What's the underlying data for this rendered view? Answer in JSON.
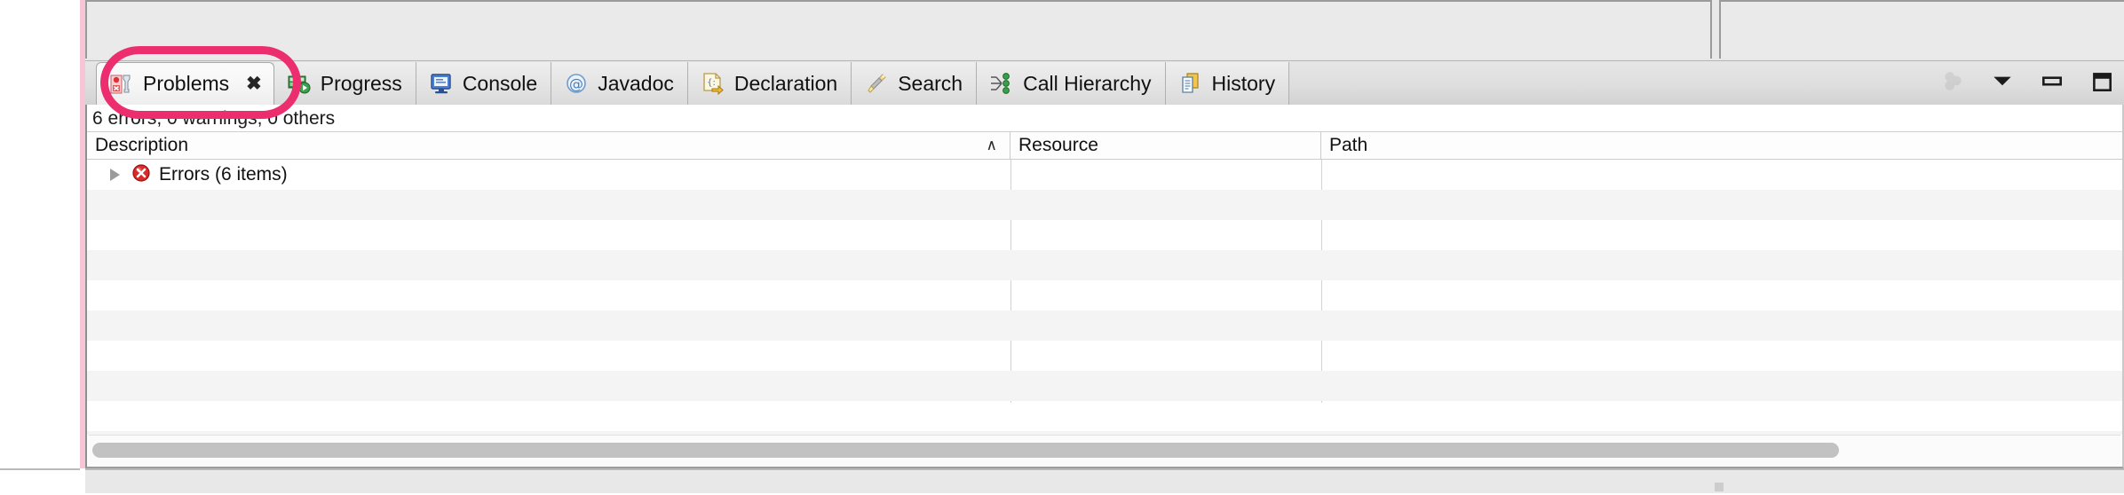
{
  "view": {
    "title": "Problems",
    "summary": "6 errors, 0 warnings, 0 others"
  },
  "tabs": [
    {
      "label": "Problems",
      "icon": "problems-icon",
      "active": true,
      "closable": true,
      "close_glyph": "✖"
    },
    {
      "label": "Progress",
      "icon": "progress-icon",
      "active": false,
      "closable": false,
      "close_glyph": ""
    },
    {
      "label": "Console",
      "icon": "console-icon",
      "active": false,
      "closable": false,
      "close_glyph": ""
    },
    {
      "label": "Javadoc",
      "icon": "javadoc-at-icon",
      "active": false,
      "closable": false,
      "close_glyph": ""
    },
    {
      "label": "Declaration",
      "icon": "declaration-icon",
      "active": false,
      "closable": false,
      "close_glyph": ""
    },
    {
      "label": "Search",
      "icon": "search-icon",
      "active": false,
      "closable": false,
      "close_glyph": ""
    },
    {
      "label": "Call Hierarchy",
      "icon": "call-hierarchy-icon",
      "active": false,
      "closable": false,
      "close_glyph": ""
    },
    {
      "label": "History",
      "icon": "history-icon",
      "active": false,
      "closable": false,
      "close_glyph": ""
    }
  ],
  "stack_toolbar": [
    {
      "name": "filters-icon",
      "tooltip": "Filters",
      "faded": true
    },
    {
      "name": "view-menu-icon",
      "tooltip": "View Menu",
      "faded": false
    },
    {
      "name": "minimize-icon",
      "tooltip": "Minimize",
      "faded": false
    },
    {
      "name": "maximize-icon",
      "tooltip": "Maximize",
      "faded": false
    }
  ],
  "table": {
    "columns": [
      {
        "key": "description",
        "label": "Description",
        "sorted": true,
        "sort_glyph": "∧"
      },
      {
        "key": "resource",
        "label": "Resource",
        "sorted": false,
        "sort_glyph": ""
      },
      {
        "key": "path",
        "label": "Path",
        "sorted": false,
        "sort_glyph": ""
      }
    ],
    "rows": [
      {
        "description": "Errors (6 items)",
        "resource": "",
        "path": "",
        "icon": "error-icon",
        "expanded": false,
        "twisty": true
      }
    ],
    "empty_row_count": 10
  },
  "scrollbar": {
    "orientation": "horizontal",
    "thumb_name": "horizontal-scroll-thumb"
  },
  "annotation": {
    "name": "pink-highlight-ellipse",
    "color": "#ec2d6e",
    "targets": "problems-tab"
  }
}
